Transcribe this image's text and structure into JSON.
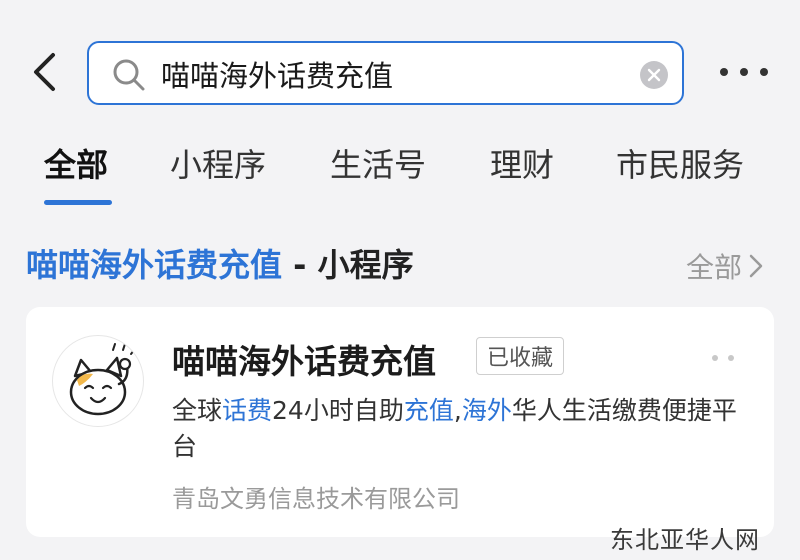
{
  "search": {
    "query": "喵喵海外话费充值"
  },
  "tabs": [
    {
      "label": "全部",
      "active": true
    },
    {
      "label": "小程序",
      "active": false
    },
    {
      "label": "生活号",
      "active": false
    },
    {
      "label": "理财",
      "active": false
    },
    {
      "label": "市民服务",
      "active": false
    }
  ],
  "section": {
    "title_highlight": "喵喵海外话费充值",
    "title_rest": " - 小程序",
    "see_all": "全部"
  },
  "result": {
    "name": "喵喵海外话费充值",
    "badge": "已收藏",
    "desc_parts": [
      {
        "text": "全球",
        "hl": false
      },
      {
        "text": "话费",
        "hl": true
      },
      {
        "text": "24小时自助",
        "hl": false
      },
      {
        "text": "充值",
        "hl": true
      },
      {
        "text": ",",
        "hl": false
      },
      {
        "text": "海外",
        "hl": true
      },
      {
        "text": "华人生活缴费便捷平台",
        "hl": false
      }
    ],
    "company": "青岛文勇信息技术有限公司"
  },
  "watermark": "东北亚华人网",
  "colors": {
    "accent": "#2d74d6",
    "background": "#f3f3f5",
    "muted": "#9a9a9a"
  },
  "icons": [
    "back-chevron-icon",
    "search-icon",
    "clear-icon",
    "more-icon",
    "chevron-right-icon",
    "cat-logo-icon"
  ]
}
